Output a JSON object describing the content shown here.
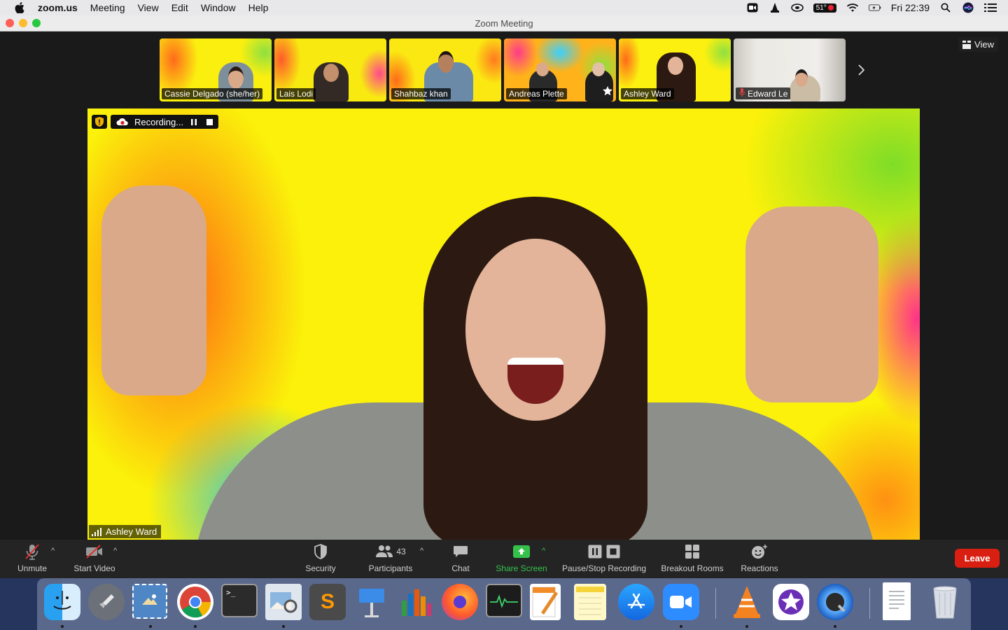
{
  "menubar": {
    "app_name": "zoom.us",
    "menus": [
      "Meeting",
      "View",
      "Edit",
      "Window",
      "Help"
    ],
    "temperature": "51°",
    "clock": "Fri 22:39"
  },
  "window": {
    "title": "Zoom Meeting"
  },
  "gallery": {
    "participants": [
      {
        "name": "Cassie Delgado (she/her)"
      },
      {
        "name": "Lais Lodi"
      },
      {
        "name": "Shahbaz khan"
      },
      {
        "name": "Andreas Plette"
      },
      {
        "name": "Ashley Ward"
      },
      {
        "name": "Edward Le"
      }
    ],
    "view_label": "View"
  },
  "main_video": {
    "recording_label": "Recording...",
    "speaker_name": "Ashley Ward"
  },
  "toolbar": {
    "unmute_label": "Unmute",
    "start_video_label": "Start Video",
    "security_label": "Security",
    "participants_label": "Participants",
    "participants_count": "43",
    "chat_label": "Chat",
    "share_screen_label": "Share Screen",
    "recording_label": "Pause/Stop Recording",
    "breakout_label": "Breakout Rooms",
    "reactions_label": "Reactions",
    "leave_label": "Leave"
  },
  "colors": {
    "accent_green": "#35c24b",
    "leave_red": "#d91f11",
    "toolbar_bg": "#242424"
  },
  "dock": {
    "apps": [
      "finder-icon",
      "launchpad-icon",
      "mail-stamp-icon",
      "chrome-icon",
      "terminal-icon",
      "preview-icon",
      "sublime-text-icon",
      "keynote-icon",
      "numbers-icon",
      "firefox-icon",
      "activity-monitor-icon",
      "pages-icon",
      "notes-icon",
      "app-store-icon",
      "zoom-icon",
      "vlc-icon",
      "imovie-icon",
      "quicktime-icon",
      "document-icon",
      "trash-icon"
    ]
  }
}
